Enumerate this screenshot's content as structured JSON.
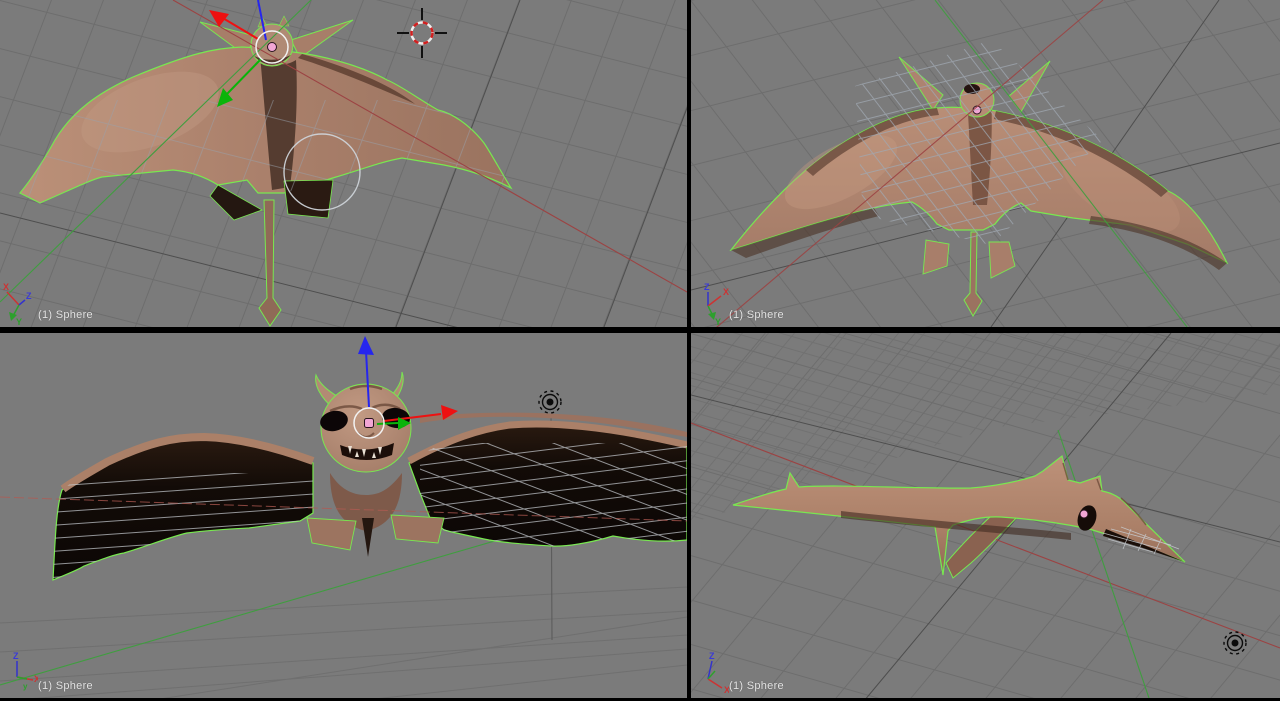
{
  "viewports": [
    {
      "id": "top-left",
      "status_label": "(1) Sphere",
      "gizmo": {
        "x": "X",
        "y": "Y",
        "z": "Z"
      },
      "contents": [
        "creature-mesh-selected",
        "translate-manipulator",
        "3d-cursor",
        "circle-select-brush"
      ]
    },
    {
      "id": "top-right",
      "status_label": "(1) Sphere",
      "gizmo": {
        "x": "X",
        "y": "Y",
        "z": "Z"
      },
      "contents": [
        "creature-mesh-selected"
      ]
    },
    {
      "id": "bottom-left",
      "status_label": "(1) Sphere",
      "gizmo": {
        "x": "X",
        "y": "y",
        "z": "Z"
      },
      "contents": [
        "creature-mesh-selected",
        "translate-manipulator",
        "lamp"
      ]
    },
    {
      "id": "bottom-right",
      "status_label": "(1) Sphere",
      "gizmo": {
        "x": "X",
        "z": "Z"
      },
      "contents": [
        "creature-mesh-selected",
        "lamp"
      ]
    }
  ],
  "colors": {
    "viewport_background": "#7b7b7b",
    "grid_line": "#6d6d6d",
    "grid_line_dark": "#4e4e4e",
    "divider": "#000000",
    "x_axis_line": "#9c4343",
    "y_axis_line": "#3f9e3f",
    "selection_outline": "#78e850",
    "manipulator_x": "#ee1111",
    "manipulator_y": "#0ab40a",
    "manipulator_z": "#2626ee",
    "object_center_dot": "#f2a6d5",
    "creature_skin": "#ab8068",
    "wing_underside": "#120b07",
    "lamp_icon": "#0a0a0a",
    "cursor_ring_red": "#d02020",
    "label_text": "#e4e4e4"
  }
}
